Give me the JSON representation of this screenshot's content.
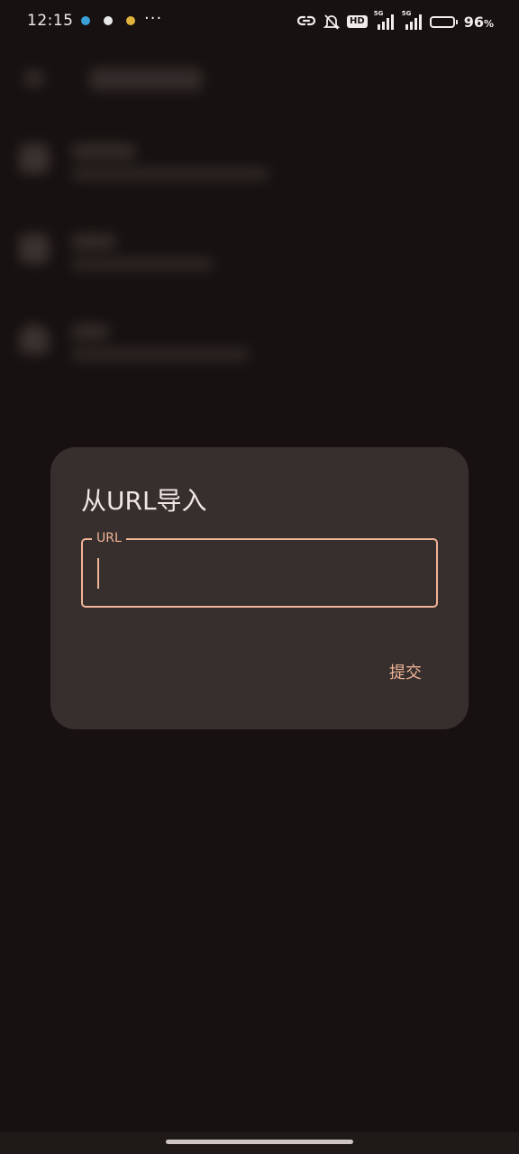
{
  "status_bar": {
    "time": "12:15",
    "more_indicator": "···",
    "notification_icons": [
      {
        "name": "app-notification-icon",
        "color": "#3aa0d8"
      },
      {
        "name": "chat-notification-icon",
        "color": "#e8e8e8"
      },
      {
        "name": "chrome-notification-icon",
        "color": "#e0b43c"
      }
    ],
    "hd_label": "HD",
    "network_1": "5G",
    "network_2": "5G",
    "battery_percent": "96",
    "battery_unit": "%",
    "battery_level": 0.96
  },
  "dialog": {
    "title": "从URL导入",
    "url_field": {
      "label": "URL",
      "value": "",
      "placeholder": ""
    },
    "submit_label": "提交"
  },
  "colors": {
    "background": "#171211",
    "dialog_surface": "#372f2d",
    "accent": "#f0b498",
    "text_primary": "#efe6e3"
  }
}
